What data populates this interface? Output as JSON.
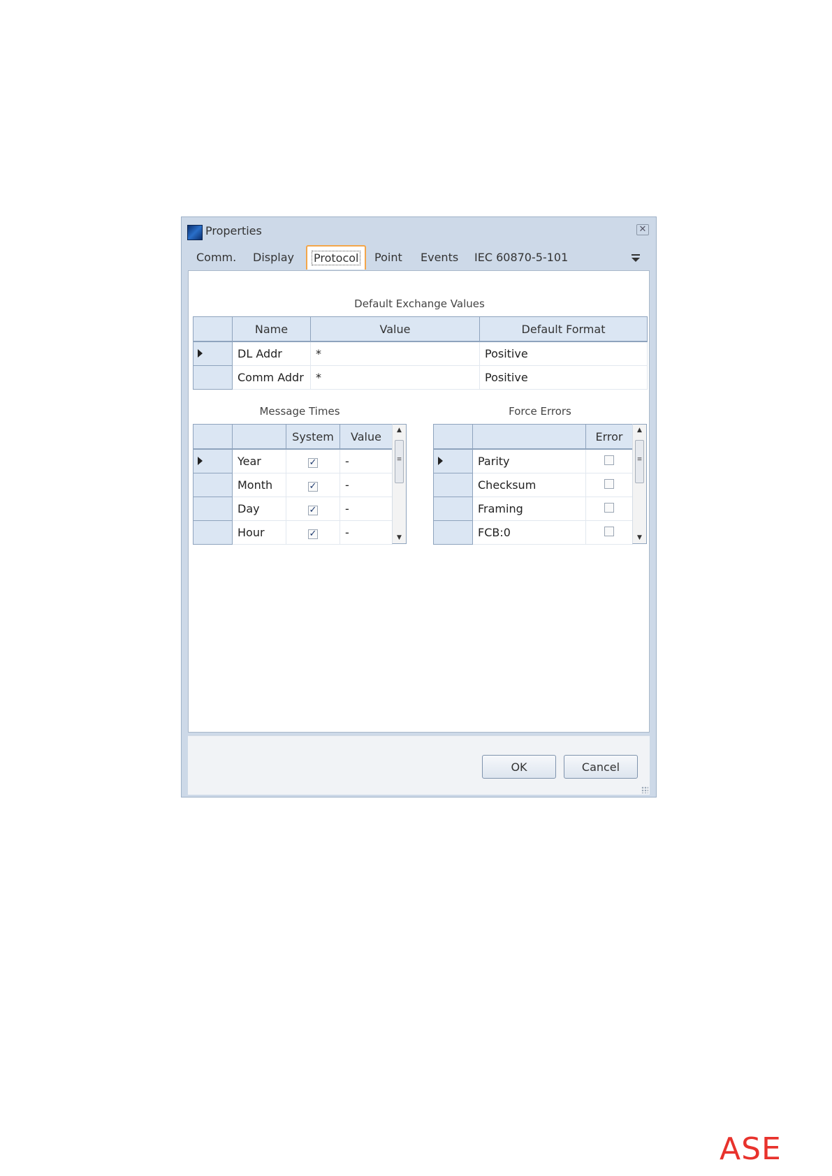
{
  "window": {
    "title": "Properties"
  },
  "tabs": [
    "Comm.",
    "Display",
    "Protocol",
    "Point",
    "Events",
    "IEC 60870-5-101"
  ],
  "active_tab": "Protocol",
  "default_exchange": {
    "title": "Default Exchange Values",
    "columns": [
      "Name",
      "Value",
      "Default Format"
    ],
    "rows": [
      {
        "name": "DL Addr",
        "value": "*",
        "format": "Positive",
        "current": true
      },
      {
        "name": "Comm Addr",
        "value": "*",
        "format": "Positive",
        "current": false
      }
    ]
  },
  "message_times": {
    "title": "Message Times",
    "columns": [
      "",
      "System",
      "Value"
    ],
    "rows": [
      {
        "name": "Year",
        "system": true,
        "value": "-",
        "current": true
      },
      {
        "name": "Month",
        "system": true,
        "value": "-",
        "current": false
      },
      {
        "name": "Day",
        "system": true,
        "value": "-",
        "current": false
      },
      {
        "name": "Hour",
        "system": true,
        "value": "-",
        "current": false
      }
    ]
  },
  "force_errors": {
    "title": "Force Errors",
    "columns": [
      "",
      "Error"
    ],
    "rows": [
      {
        "name": "Parity",
        "error": false,
        "current": true
      },
      {
        "name": "Checksum",
        "error": false,
        "current": false
      },
      {
        "name": "Framing",
        "error": false,
        "current": false
      },
      {
        "name": "FCB:0",
        "error": false,
        "current": false
      }
    ]
  },
  "buttons": {
    "ok": "OK",
    "cancel": "Cancel"
  },
  "logo": "ASE",
  "icons": {
    "app": "properties-app-icon",
    "close": "close-icon",
    "tab_menu": "tab-overflow-icon",
    "row_pointer": "row-pointer-icon",
    "check": "checkbox-check-icon",
    "scroll_up": "scroll-up-arrow-icon",
    "scroll_down": "scroll-down-arrow-icon",
    "grip": "resize-grip-icon"
  },
  "colors": {
    "accent_tab": "#f3a64a",
    "header_bg": "#dbe6f3",
    "logo": "#e8322c"
  }
}
